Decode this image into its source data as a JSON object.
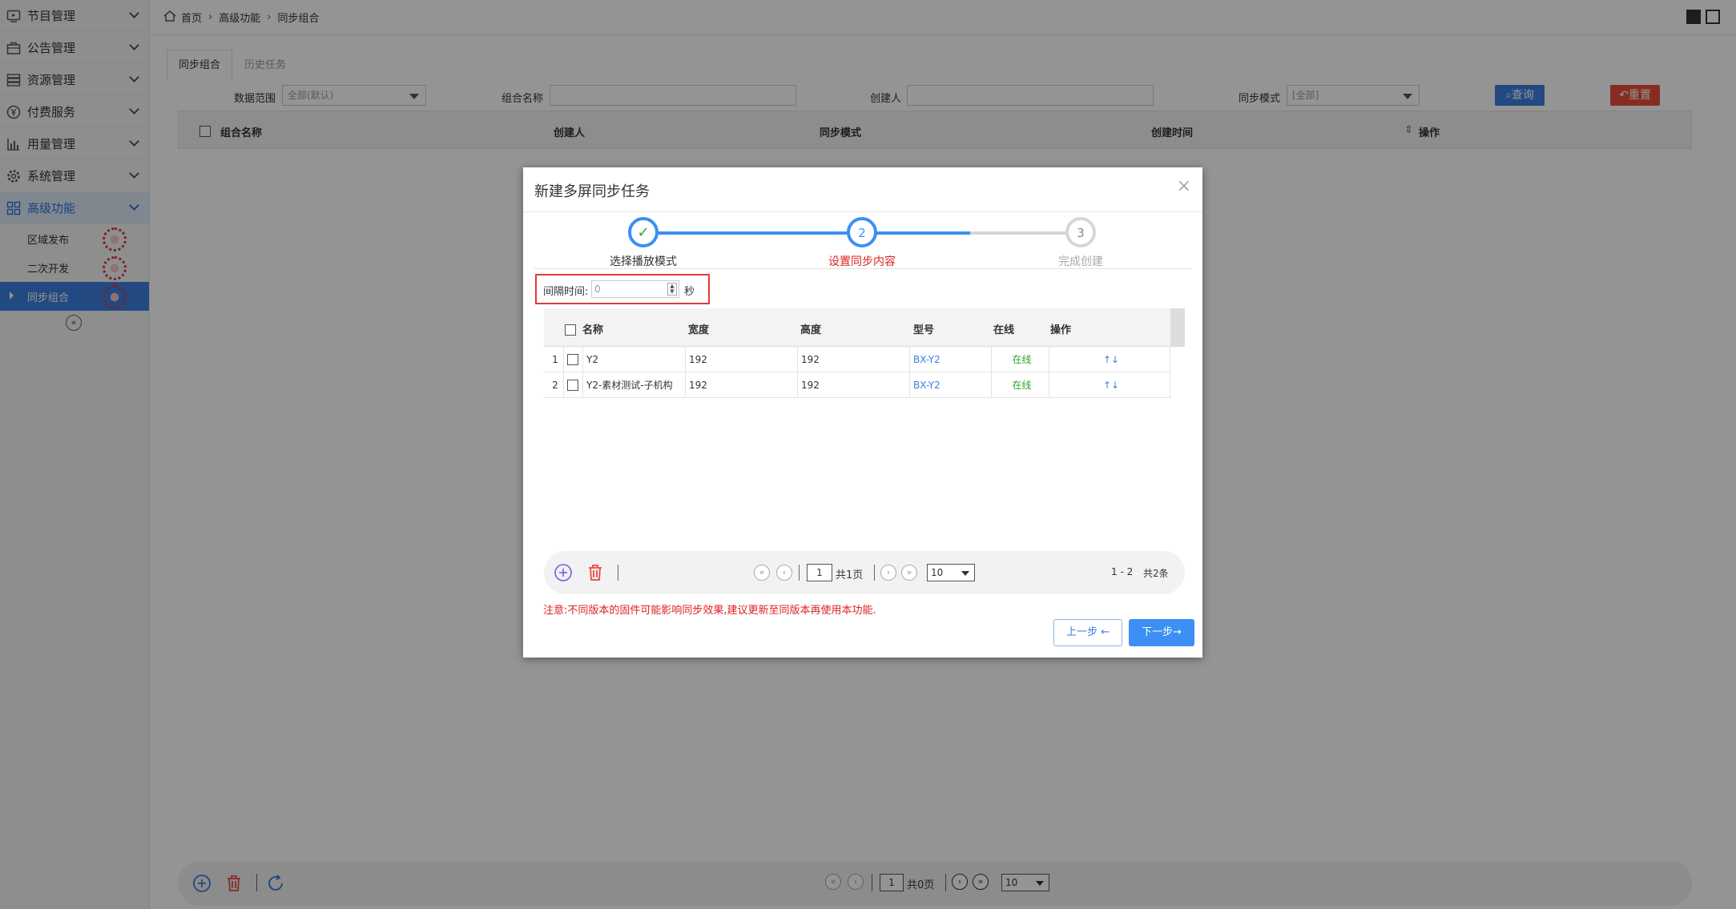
{
  "sidebar": {
    "items": [
      {
        "label": "节目管理",
        "icon": "tv-icon"
      },
      {
        "label": "公告管理",
        "icon": "briefcase-icon"
      },
      {
        "label": "资源管理",
        "icon": "server-icon"
      },
      {
        "label": "付费服务",
        "icon": "yen-icon"
      },
      {
        "label": "用量管理",
        "icon": "bar-chart-icon"
      },
      {
        "label": "系统管理",
        "icon": "gear-icon"
      },
      {
        "label": "高级功能",
        "icon": "grid-icon"
      }
    ],
    "sub_items": [
      {
        "label": "区域发布"
      },
      {
        "label": "二次开发"
      },
      {
        "label": "同步组合"
      }
    ],
    "collapse": "«"
  },
  "breadcrumb": {
    "home": "首页",
    "level2": "高级功能",
    "level3": "同步组合",
    "sep": "›"
  },
  "tabs": [
    {
      "label": "同步组合"
    },
    {
      "label": "历史任务"
    }
  ],
  "filters": {
    "scope_label": "数据范围",
    "scope_value": "全部(默认)",
    "group_name_label": "组合名称",
    "creator_label": "创建人",
    "sync_mode_label": "同步模式",
    "sync_mode_value": "[全部]",
    "query_label": "查询",
    "reset_label": "重置"
  },
  "grid": {
    "headers": [
      "组合名称",
      "创建人",
      "同步模式",
      "创建时间",
      "操作"
    ]
  },
  "bottom_pager": {
    "page": "1",
    "total_pages": "共0页",
    "page_size": "10"
  },
  "modal": {
    "title": "新建多屏同步任务",
    "close": "×",
    "steps": [
      {
        "label": "选择播放模式",
        "num": "✓"
      },
      {
        "label": "设置同步内容",
        "num": "2"
      },
      {
        "label": "完成创建",
        "num": "3"
      }
    ],
    "interval_label": "间隔时间:",
    "interval_value": "0",
    "interval_unit": "秒",
    "table": {
      "headers": [
        "名称",
        "宽度",
        "高度",
        "型号",
        "在线",
        "操作"
      ],
      "rows": [
        {
          "idx": "1",
          "name": "Y2",
          "width": "192",
          "height": "192",
          "model": "BX-Y2",
          "online": "在线",
          "ops": "↑↓"
        },
        {
          "idx": "2",
          "name": "Y2-素材测试-子机构",
          "width": "192",
          "height": "192",
          "model": "BX-Y2",
          "online": "在线",
          "ops": "↑↓"
        }
      ]
    },
    "pager": {
      "page": "1",
      "total_pages": "共1页",
      "page_size": "10",
      "range": "1 - 2",
      "total": "共2条"
    },
    "notice": "注意:不同版本的固件可能影响同步效果,建议更新至同版本再使用本功能.",
    "prev_label": "上一步 ←",
    "next_label": "下一步→"
  },
  "colors": {
    "accent": "#3b7fe0",
    "danger": "#e74c3c",
    "online": "#2aa52a"
  }
}
